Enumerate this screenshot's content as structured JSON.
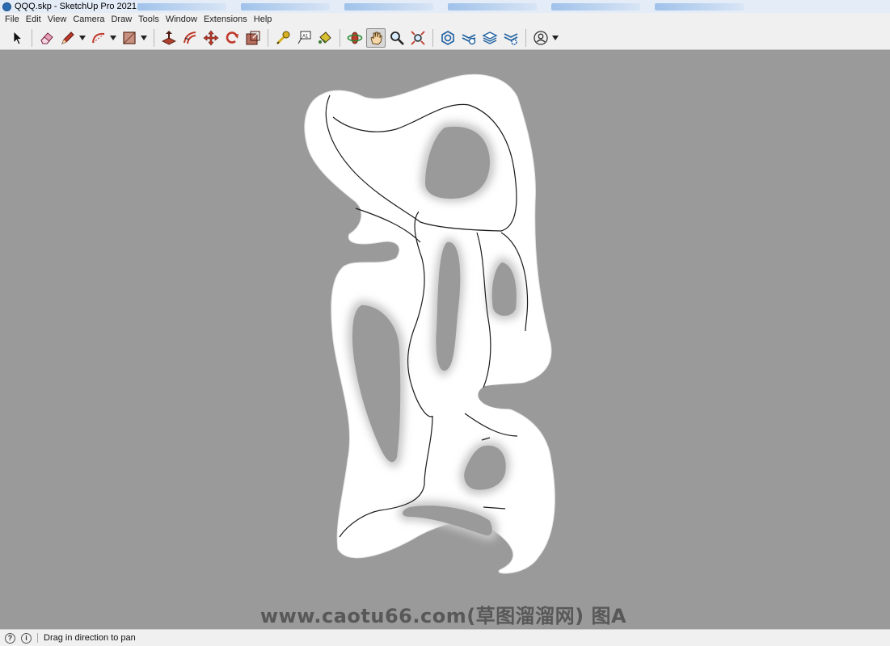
{
  "window": {
    "title": "QQQ.skp - SketchUp Pro 2021"
  },
  "menu": [
    "File",
    "Edit",
    "View",
    "Camera",
    "Draw",
    "Tools",
    "Window",
    "Extensions",
    "Help"
  ],
  "toolbar": {
    "buttons": [
      {
        "name": "select-tool",
        "icon": "arrow-cursor-icon"
      },
      {
        "name": "eraser-tool",
        "icon": "eraser-icon"
      },
      {
        "name": "pencil-line-tool",
        "icon": "pencil-icon",
        "dropdown": true
      },
      {
        "name": "arc-tool",
        "icon": "arc-icon",
        "dropdown": true
      },
      {
        "name": "rectangle-tool",
        "icon": "rectangle-icon",
        "dropdown": true
      },
      {
        "name": "push-pull-tool",
        "icon": "push-pull-icon"
      },
      {
        "name": "offset-tool",
        "icon": "offset-icon"
      },
      {
        "name": "move-tool",
        "icon": "move-icon"
      },
      {
        "name": "rotate-tool",
        "icon": "rotate-icon"
      },
      {
        "name": "scale-tool",
        "icon": "scale-icon"
      },
      {
        "name": "tape-measure-tool",
        "icon": "tape-measure-icon"
      },
      {
        "name": "text-tool",
        "icon": "text-label-icon"
      },
      {
        "name": "paint-bucket-tool",
        "icon": "paint-bucket-icon"
      },
      {
        "name": "orbit-tool",
        "icon": "orbit-icon"
      },
      {
        "name": "pan-tool",
        "icon": "hand-icon",
        "active": true
      },
      {
        "name": "zoom-tool",
        "icon": "magnifier-icon"
      },
      {
        "name": "zoom-extents-tool",
        "icon": "zoom-extents-icon"
      },
      {
        "name": "3d-warehouse-button",
        "icon": "warehouse-icon"
      },
      {
        "name": "extension-warehouse-button",
        "icon": "extension-warehouse-icon"
      },
      {
        "name": "layout-button",
        "icon": "layers-icon"
      },
      {
        "name": "extension-manager-button",
        "icon": "extension-manager-icon"
      },
      {
        "name": "account-button",
        "icon": "user-account-icon",
        "dropdown": true
      }
    ]
  },
  "colors": {
    "viewport_bg": "#9a9a9a",
    "model_fill": "#ffffff",
    "edge": "#1a1a1a",
    "accent_red": "#c0392b",
    "accent_blue": "#2b6cb0"
  },
  "watermark": "www.caotu66.com(草图溜溜网) 图A",
  "status": {
    "message": "Drag in direction to pan"
  }
}
